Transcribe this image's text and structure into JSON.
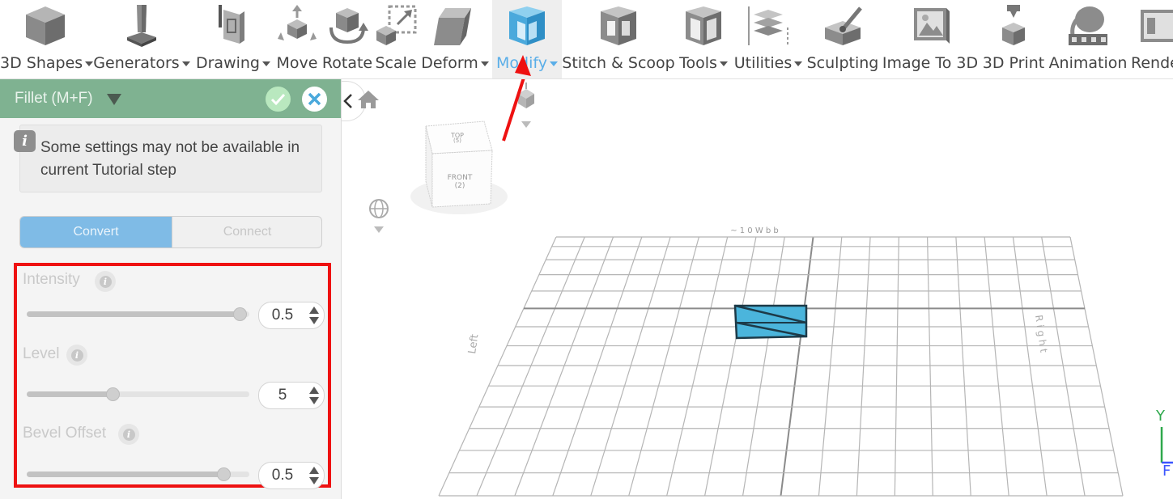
{
  "toolbar": {
    "items": [
      {
        "label": "3D Shapes",
        "has_menu": true
      },
      {
        "label": "Generators",
        "has_menu": true
      },
      {
        "label": "Drawing",
        "has_menu": true
      },
      {
        "label": "Move",
        "has_menu": false
      },
      {
        "label": "Rotate",
        "has_menu": false
      },
      {
        "label": "Scale",
        "has_menu": false
      },
      {
        "label": "Deform",
        "has_menu": true
      },
      {
        "label": "Modify",
        "has_menu": true,
        "active": true
      },
      {
        "label": "Stitch & Scoop",
        "has_menu": false
      },
      {
        "label": "Tools",
        "has_menu": true
      },
      {
        "label": "Utilities",
        "has_menu": true
      },
      {
        "label": "Sculpting",
        "has_menu": false
      },
      {
        "label": "Image To 3D",
        "has_menu": false
      },
      {
        "label": "3D Print",
        "has_menu": false
      },
      {
        "label": "Animation",
        "has_menu": false
      },
      {
        "label": "Rende",
        "has_menu": false
      }
    ]
  },
  "panel": {
    "title": "Fillet (M+F)",
    "notice": "Some settings may not be available in current Tutorial step",
    "info_glyph": "i",
    "segments": {
      "convert": "Convert",
      "connect": "Connect",
      "selected": "Convert"
    },
    "params": [
      {
        "label": "Intensity",
        "value": "0.5",
        "slider_fraction": 0.99
      },
      {
        "label": "Level",
        "value": "5",
        "slider_fraction": 0.38
      },
      {
        "label": "Bevel Offset",
        "value": "0.5",
        "slider_fraction": 0.91
      }
    ]
  },
  "viewcube": {
    "top": "TOP",
    "top_num": "(5)",
    "front": "FRONT",
    "front_num": "(2)"
  },
  "grid_labels": {
    "back": "~ 1 0 W b b",
    "left": "Left",
    "right": "R i g h t"
  },
  "axes": {
    "y": "Y",
    "color_y": "#2ea84c",
    "color_x": "#3a55ff"
  },
  "colors": {
    "accent": "#5aaee8",
    "panel_header": "#7fb291",
    "highlight": "#ee1111",
    "object": "#4bb5dc"
  }
}
